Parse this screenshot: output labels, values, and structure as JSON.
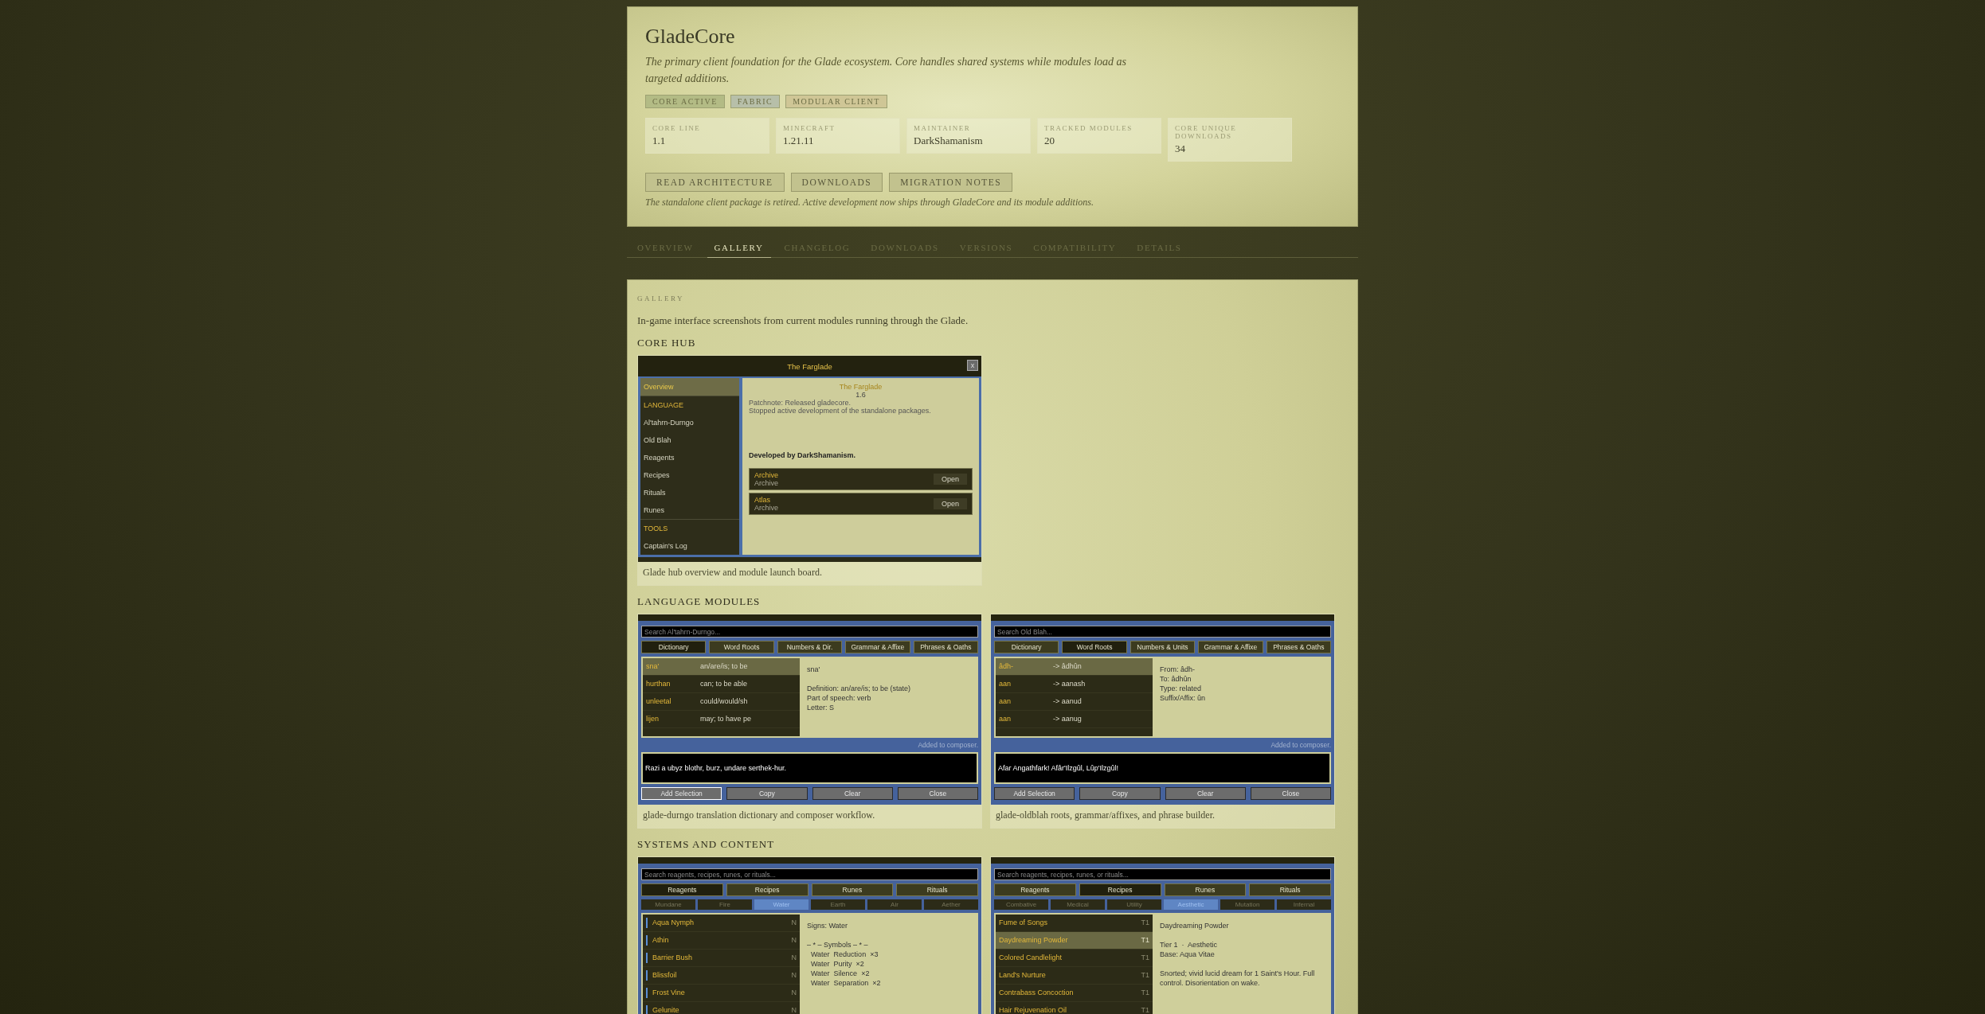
{
  "project": {
    "title": "GladeCore",
    "description": "The primary client foundation for the Glade ecosystem. Core handles shared systems while modules load as targeted additions.",
    "tags": [
      {
        "label": "CORE ACTIVE",
        "color": "#b3bb85"
      },
      {
        "label": "FABRIC",
        "color": "#b7bfa9"
      },
      {
        "label": "MODULAR CLIENT",
        "color": "#cfc696"
      }
    ],
    "stats": [
      {
        "label": "CORE LINE",
        "value": "1.1"
      },
      {
        "label": "MINECRAFT",
        "value": "1.21.11"
      },
      {
        "label": "MAINTAINER",
        "value": "DarkShamanism"
      },
      {
        "label": "TRACKED MODULES",
        "value": "20"
      },
      {
        "label": "CORE UNIQUE DOWNLOADS",
        "value": "34"
      }
    ],
    "buttons": [
      "READ ARCHITECTURE",
      "DOWNLOADS",
      "MIGRATION NOTES"
    ],
    "note": "The standalone client package is retired. Active development now ships through GladeCore and its module additions."
  },
  "tabs": [
    {
      "label": "OVERVIEW",
      "selected": false
    },
    {
      "label": "GALLERY",
      "selected": true
    },
    {
      "label": "CHANGELOG",
      "selected": false
    },
    {
      "label": "DOWNLOADS",
      "selected": false
    },
    {
      "label": "VERSIONS",
      "selected": false
    },
    {
      "label": "COMPATIBILITY",
      "selected": false
    },
    {
      "label": "DETAILS",
      "selected": false
    }
  ],
  "gallery": {
    "heading": "GALLERY",
    "intro": "In-game interface screenshots from current modules running through the Glade.",
    "sections": [
      {
        "title": "CORE HUB",
        "shots": [
          {
            "caption": "Glade hub overview and module launch board.",
            "screen": {
              "kind": "hub",
              "title": "The Farglade",
              "close": "x",
              "sidebar": [
                {
                  "label": "Overview",
                  "kind": "item",
                  "selected": true
                },
                {
                  "label": "LANGUAGE",
                  "kind": "header",
                  "selected": false
                },
                {
                  "label": "Al'tahrn-Durngo",
                  "kind": "item",
                  "selected": false
                },
                {
                  "label": "Old Blah",
                  "kind": "item",
                  "selected": false
                },
                {
                  "label": "Reagents",
                  "kind": "item",
                  "selected": false
                },
                {
                  "label": "Recipes",
                  "kind": "item",
                  "selected": false
                },
                {
                  "label": "Rituals",
                  "kind": "item",
                  "selected": false
                },
                {
                  "label": "Runes",
                  "kind": "item",
                  "selected": false
                },
                {
                  "label": "TOOLS",
                  "kind": "header",
                  "selected": false
                },
                {
                  "label": "Captain's Log",
                  "kind": "item",
                  "selected": false
                }
              ],
              "heading": "The Farglade",
              "version": "1.6",
              "notes": [
                "Patchnote: Released gladecore.",
                "Stopped active development of the standalone packages."
              ],
              "credit": "Developed by DarkShamanism.",
              "cards": [
                {
                  "title": "Archive",
                  "subtitle": "Archive",
                  "button": "Open"
                },
                {
                  "title": "Atlas",
                  "subtitle": "Archive",
                  "button": "Open"
                }
              ]
            }
          }
        ]
      },
      {
        "title": "LANGUAGE MODULES",
        "shots": [
          {
            "caption": "glade-durngo translation dictionary and composer workflow.",
            "screen": {
              "kind": "dictionary",
              "placeholder": "Search Al'tahrn-Durngo...",
              "tabs": [
                {
                  "label": "Dictionary",
                  "selected": true
                },
                {
                  "label": "Word Roots",
                  "selected": false
                },
                {
                  "label": "Numbers & Dir.",
                  "selected": false
                },
                {
                  "label": "Grammar & Affixe",
                  "selected": false
                },
                {
                  "label": "Phrases & Oaths",
                  "selected": false
                }
              ],
              "rows": [
                {
                  "term": "sna'",
                  "gloss": "an/are/is; to be",
                  "selected": true
                },
                {
                  "term": "hurthan",
                  "gloss": "can; to be able",
                  "selected": false
                },
                {
                  "term": "unleetal",
                  "gloss": "could/would/sh",
                  "selected": false
                },
                {
                  "term": "lijen",
                  "gloss": "may; to have pe",
                  "selected": false
                }
              ],
              "detail": [
                [
                  "sna'"
                ],
                [
                  "Definition: an/are/is; to be (state)",
                  "Part of speech: verb",
                  "Letter: S"
                ]
              ],
              "status": "Added to composer.",
              "composer": "Razi a ubyz blothr, burz, undare serthek-hur.",
              "buttons": [
                {
                  "label": "Add Selection",
                  "focused": true
                },
                {
                  "label": "Copy",
                  "focused": false
                },
                {
                  "label": "Clear",
                  "focused": false
                },
                {
                  "label": "Close",
                  "focused": false
                }
              ]
            }
          },
          {
            "caption": "glade-oldblah roots, grammar/affixes, and phrase builder.",
            "screen": {
              "kind": "dictionary",
              "placeholder": "Search Old Blah...",
              "tabs": [
                {
                  "label": "Dictionary",
                  "selected": false
                },
                {
                  "label": "Word Roots",
                  "selected": true
                },
                {
                  "label": "Numbers & Units",
                  "selected": false
                },
                {
                  "label": "Grammar & Affixe",
                  "selected": false
                },
                {
                  "label": "Phrases & Oaths",
                  "selected": false
                }
              ],
              "rows": [
                {
                  "term": "âdh-",
                  "gloss": "-> âdhûn",
                  "selected": true
                },
                {
                  "term": "aan",
                  "gloss": "-> aanash",
                  "selected": false
                },
                {
                  "term": "aan",
                  "gloss": "-> aanud",
                  "selected": false
                },
                {
                  "term": "aan",
                  "gloss": "-> aanug",
                  "selected": false
                }
              ],
              "detail": [
                [
                  "From: âdh-",
                  "To: âdhûn",
                  "Type: related",
                  "Suffix/Affix: ûn"
                ]
              ],
              "status": "Added to composer.",
              "composer": "Afar Angathfark! Afâr'Ilzgûl, Lûp'Ilzgûl!",
              "buttons": [
                {
                  "label": "Add Selection",
                  "focused": false
                },
                {
                  "label": "Copy",
                  "focused": false
                },
                {
                  "label": "Clear",
                  "focused": false
                },
                {
                  "label": "Close",
                  "focused": false
                }
              ]
            }
          }
        ]
      },
      {
        "title": "SYSTEMS AND CONTENT",
        "shots": [
          {
            "screen": {
              "kind": "codex",
              "placeholder": "Search reagents, recipes, runes, or rituals...",
              "tabs": [
                {
                  "label": "Reagents",
                  "selected": true
                },
                {
                  "label": "Recipes",
                  "selected": false
                },
                {
                  "label": "Runes",
                  "selected": false
                },
                {
                  "label": "Rituals",
                  "selected": false
                }
              ],
              "subtabs": [
                {
                  "label": "Mundane",
                  "selected": false
                },
                {
                  "label": "Fire",
                  "selected": false
                },
                {
                  "label": "Water",
                  "selected": true
                },
                {
                  "label": "Earth",
                  "selected": false
                },
                {
                  "label": "Air",
                  "selected": false
                },
                {
                  "label": "Aether",
                  "selected": false
                }
              ],
              "rows": [
                {
                  "name": "Aqua Nymph",
                  "tag": "N",
                  "selected": false,
                  "color": "#5b8fd6"
                },
                {
                  "name": "Athin",
                  "tag": "N",
                  "selected": false,
                  "color": "#5b8fd6"
                },
                {
                  "name": "Barrier Bush",
                  "tag": "N",
                  "selected": false,
                  "color": "#5b8fd6"
                },
                {
                  "name": "Blissfoil",
                  "tag": "N",
                  "selected": false,
                  "color": "#5b8fd6"
                },
                {
                  "name": "Frost Vine",
                  "tag": "N",
                  "selected": false,
                  "color": "#5b8fd6"
                },
                {
                  "name": "Gelunite",
                  "tag": "N",
                  "selected": false,
                  "color": "#5b8fd6"
                }
              ],
              "detail": [
                [
                  "Signs: Water"
                ],
                [
                  "– * – Symbols – * –",
                  "  Water  Reduction  ×3",
                  "  Water  Purity  ×2",
                  "  Water  Silence  ×2",
                  "  Water  Separation  ×2"
                ]
              ]
            }
          },
          {
            "screen": {
              "kind": "codex",
              "placeholder": "Search reagents, recipes, runes, or rituals...",
              "tabs": [
                {
                  "label": "Reagents",
                  "selected": false
                },
                {
                  "label": "Recipes",
                  "selected": true
                },
                {
                  "label": "Runes",
                  "selected": false
                },
                {
                  "label": "Rituals",
                  "selected": false
                }
              ],
              "subtabs": [
                {
                  "label": "Combative",
                  "selected": false
                },
                {
                  "label": "Medical",
                  "selected": false
                },
                {
                  "label": "Utility",
                  "selected": false
                },
                {
                  "label": "Aesthetic",
                  "selected": true
                },
                {
                  "label": "Mutation",
                  "selected": false
                },
                {
                  "label": "Infernal",
                  "selected": false
                }
              ],
              "rows": [
                {
                  "name": "Fume of Songs",
                  "tag": "T1",
                  "selected": false
                },
                {
                  "name": "Daydreaming Powder",
                  "tag": "T1",
                  "selected": true
                },
                {
                  "name": "Colored Candlelight",
                  "tag": "T1",
                  "selected": false
                },
                {
                  "name": "Land's Nurture",
                  "tag": "T1",
                  "selected": false
                },
                {
                  "name": "Contrabass Concoction",
                  "tag": "T1",
                  "selected": false
                },
                {
                  "name": "Hair Rejuvenation Oil",
                  "tag": "T1",
                  "selected": false
                }
              ],
              "detail": [
                [
                  "Daydreaming Powder"
                ],
                [
                  "Tier 1  ·  Aesthetic",
                  "Base: Aqua Vitae"
                ],
                [
                  "Snorted; vivid lucid dream for 1 Saint's Hour. Full control. Disorientation on wake."
                ]
              ]
            }
          }
        ]
      }
    ]
  }
}
